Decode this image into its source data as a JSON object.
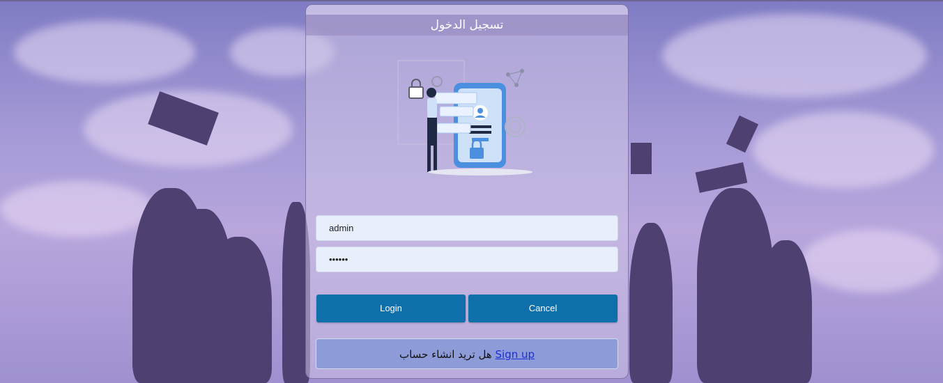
{
  "login_form": {
    "title": "تسجيل الدخول",
    "username_value": "admin",
    "password_value": "••••••",
    "login_label": "Login",
    "cancel_label": "Cancel",
    "signup_prompt": "هل تريد انشاء حساب",
    "signup_link": "Sign up"
  },
  "colors": {
    "button": "#0f6faa",
    "input_bg": "#e8eefb",
    "link": "#1a2dd8"
  },
  "icons": [
    "lock-icon",
    "user-icon",
    "gear-icon",
    "fingerprint-icon"
  ]
}
